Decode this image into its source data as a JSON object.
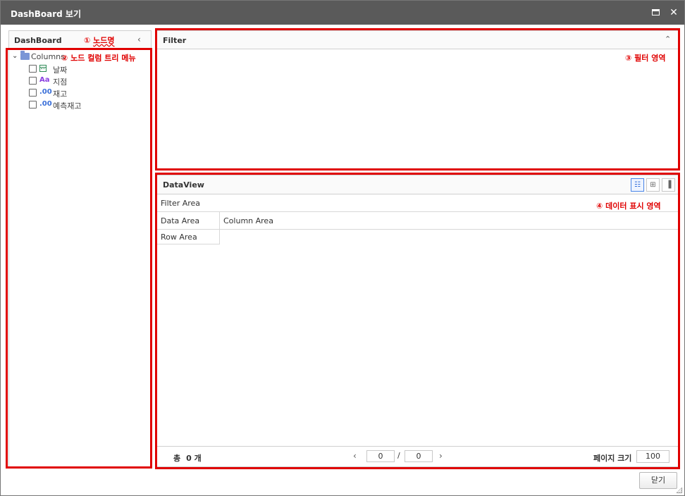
{
  "window": {
    "title": "DashBoard 보기",
    "maximize_label": "maximize",
    "close_label": "✕"
  },
  "left_panel": {
    "header": "DashBoard",
    "annotation_prefix": "①",
    "annotation_text": "노드명",
    "tree_annotation": "② 노드 컬럼 트리 메뉴",
    "root": {
      "label": "Columns",
      "icon": "folder-icon"
    },
    "items": [
      {
        "label": "날짜",
        "type_glyph": "",
        "icon": "calendar-icon"
      },
      {
        "label": "지점",
        "type_glyph": "Aa",
        "icon": "text-type-icon"
      },
      {
        "label": "재고",
        "type_glyph": ".00",
        "icon": "number-type-icon"
      },
      {
        "label": "예측재고",
        "type_glyph": ".00",
        "icon": "number-type-icon"
      }
    ]
  },
  "filter_panel": {
    "header": "Filter",
    "annotation": "③ 필터 영역"
  },
  "dataview_panel": {
    "header": "DataView",
    "annotation": "④ 데이터 표시 영역",
    "filter_area": "Filter Area",
    "data_area": "Data Area",
    "column_area": "Column Area",
    "row_area": "Row Area",
    "view_buttons": [
      "pivot-view-icon",
      "table-view-icon",
      "chart-view-icon"
    ]
  },
  "pager": {
    "total_label": "총",
    "total_count": "0 개",
    "current_page": "0",
    "total_pages": "0",
    "slash": "/",
    "page_size_label": "페이지 크기",
    "page_size": "100"
  },
  "footer": {
    "close_button": "닫기"
  },
  "colors": {
    "titlebar": "#5a5a5a",
    "annotation_red": "#e00000",
    "active_view": "#4a86e8"
  }
}
